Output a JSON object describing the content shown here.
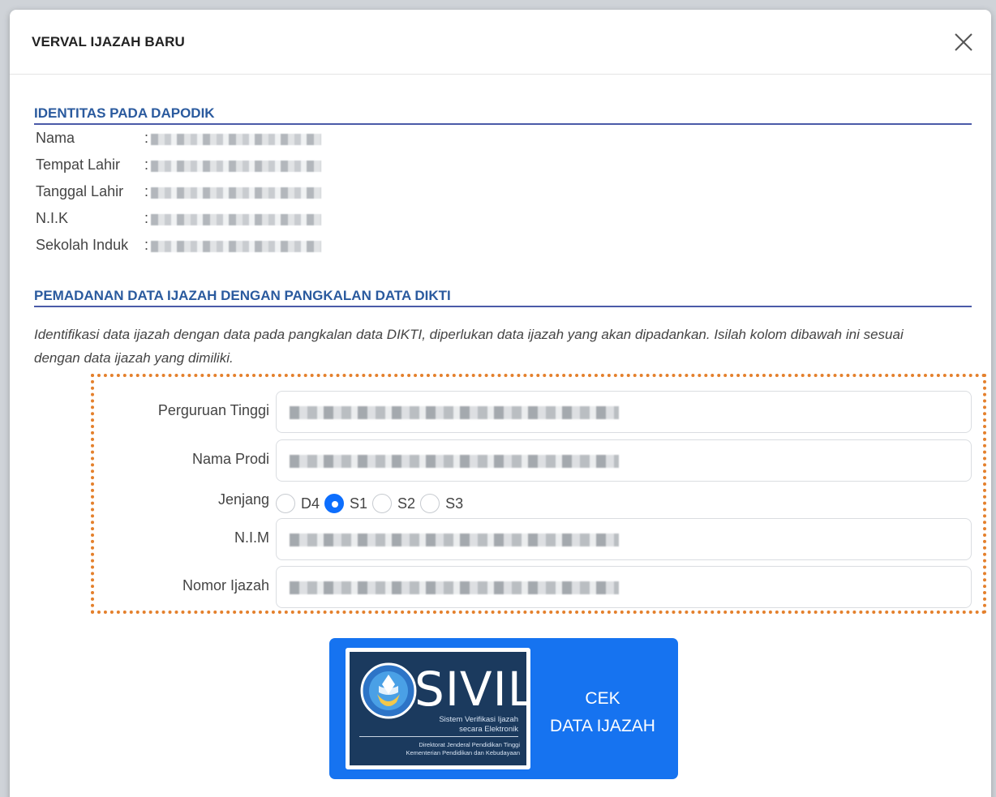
{
  "modal": {
    "title": "VERVAL IJAZAH BARU"
  },
  "identity": {
    "section_title": "IDENTITAS PADA DAPODIK",
    "rows": [
      {
        "label": "Nama",
        "colon": ":"
      },
      {
        "label": "Tempat Lahir",
        "colon": ":"
      },
      {
        "label": "Tanggal Lahir",
        "colon": ":"
      },
      {
        "label": "N.I.K",
        "colon": ":"
      },
      {
        "label": "Sekolah Induk",
        "colon": ":"
      }
    ]
  },
  "matching": {
    "section_title": "PEMADANAN DATA IJAZAH DENGAN PANGKALAN DATA DIKTI",
    "description": "Identifikasi data ijazah dengan data pada pangkalan data DIKTI, diperlukan data ijazah yang akan dipadankan. Isilah kolom dibawah ini sesuai dengan data ijazah yang dimiliki."
  },
  "form": {
    "perguruan_tinggi_label": "Perguruan Tinggi",
    "nama_prodi_label": "Nama Prodi",
    "jenjang_label": "Jenjang",
    "jenjang_options": [
      "D4",
      "S1",
      "S2",
      "S3"
    ],
    "jenjang_selected": "S1",
    "nim_label": "N.I.M",
    "nomor_ijazah_label": "Nomor Ijazah"
  },
  "button": {
    "line1": "CEK",
    "line2": "DATA IJAZAH",
    "logo": {
      "word": "SIVIL",
      "sub1": "Sistem Verifikasi Ijazah",
      "sub2": "secara Elektronik",
      "dir1": "Direktorat Jenderal Pendidikan Tinggi",
      "dir2": "Kementerian Pendidikan dan Kebudayaan"
    }
  },
  "colors": {
    "accent": "#1673f0",
    "section_title": "#2a5a9e",
    "highlight_border": "#e4802c"
  }
}
